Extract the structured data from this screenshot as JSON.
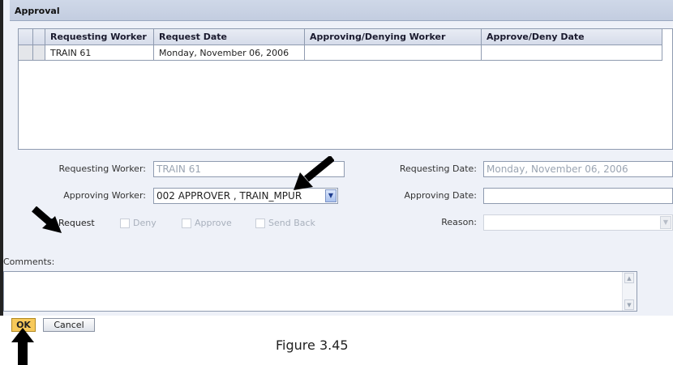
{
  "section": {
    "title": "Approval"
  },
  "grid": {
    "columns": [
      "Requesting Worker",
      "Request Date",
      "Approving/Denying Worker",
      "Approve/Deny Date"
    ],
    "rows": [
      [
        "TRAIN 61",
        "Monday, November 06, 2006",
        "",
        ""
      ]
    ]
  },
  "form": {
    "requesting_worker_label": "Requesting Worker:",
    "requesting_worker_value": "TRAIN 61",
    "requesting_date_label": "Requesting Date:",
    "requesting_date_value": "Monday, November 06, 2006",
    "approving_worker_label": "Approving Worker:",
    "approving_worker_value": "002 APPROVER , TRAIN_MPUR",
    "approving_date_label": "Approving Date:",
    "approving_date_value": "",
    "reason_label": "Reason:",
    "reason_value": "",
    "checkboxes": [
      {
        "label": "Request",
        "checked": true,
        "enabled": true
      },
      {
        "label": "Deny",
        "checked": false,
        "enabled": false
      },
      {
        "label": "Approve",
        "checked": false,
        "enabled": false
      },
      {
        "label": "Send Back",
        "checked": false,
        "enabled": false
      }
    ],
    "comments_label": "Comments:",
    "comments_value": ""
  },
  "buttons": {
    "ok": "OK",
    "cancel": "Cancel"
  },
  "caption": "Figure 3.45",
  "colors": {
    "ok_button": "#f7c95a",
    "header_bg": "#c3cde0",
    "frame_bg": "#eef1f8"
  },
  "icons": [
    "pointer-arrow-icon",
    "dropdown-arrow-icon",
    "checkmark-icon",
    "scroll-up-icon",
    "scroll-down-icon"
  ]
}
